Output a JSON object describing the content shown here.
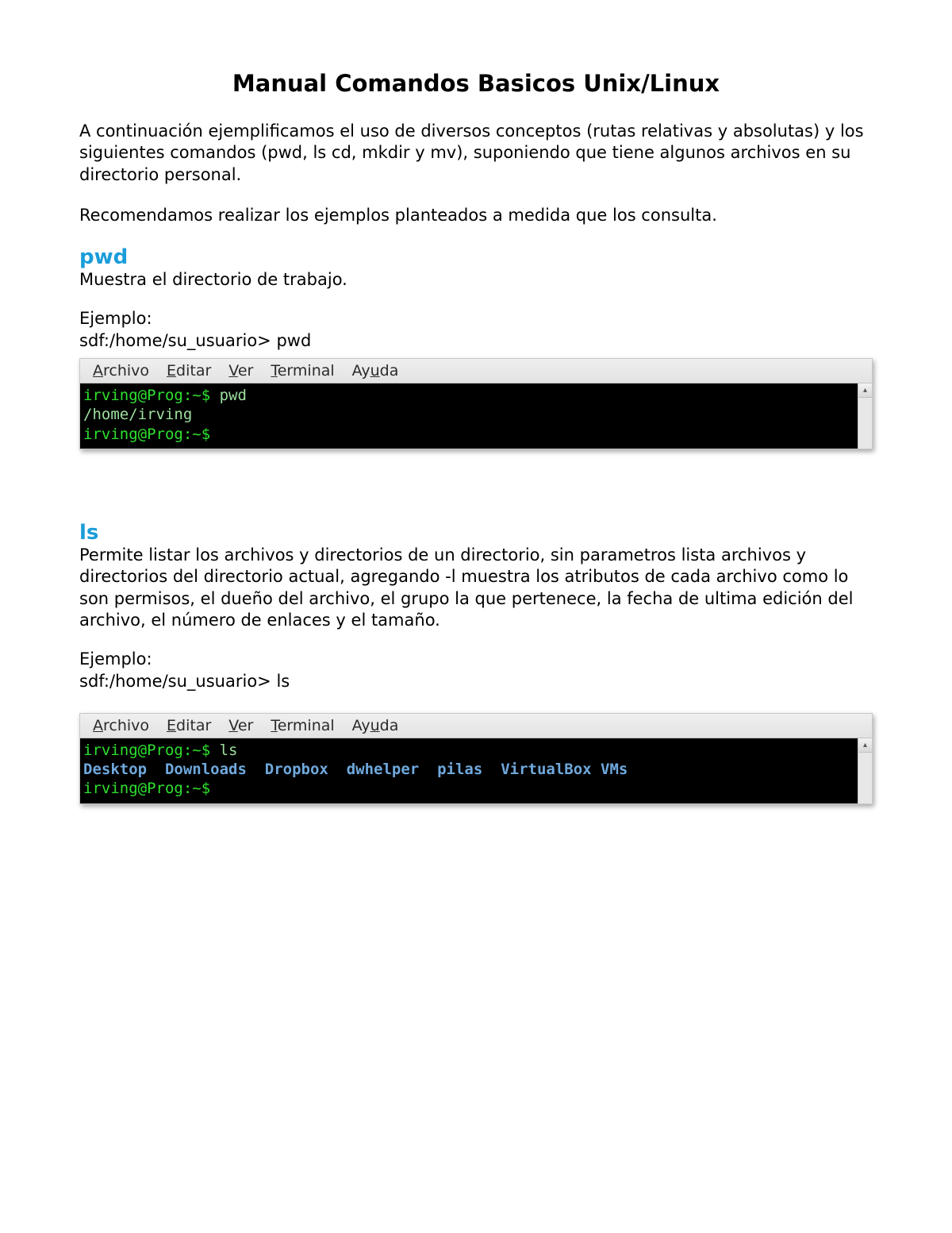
{
  "title": "Manual Comandos Basicos Unix/Linux",
  "intro1": "A continuación ejemplificamos el uso de diversos conceptos (rutas relativas y absolutas) y los siguientes comandos (pwd, ls cd, mkdir y mv), suponiendo que tiene algunos archivos en su directorio personal.",
  "intro2": "Recomendamos realizar los ejemplos planteados a medida que los consulta.",
  "menubar": {
    "archivo_u": "A",
    "archivo_r": "rchivo",
    "editar_u": "E",
    "editar_r": "ditar",
    "ver_u": "V",
    "ver_r": "er",
    "terminal_u": "T",
    "terminal_r": "erminal",
    "ayuda_pre": "Ay",
    "ayuda_u": "u",
    "ayuda_post": "da"
  },
  "pwd": {
    "heading": "pwd",
    "desc": "Muestra el directorio de trabajo.",
    "example_label": "Ejemplo:",
    "example_line": "sdf:/home/su_usuario> pwd",
    "term": {
      "prompt1": "irving@Prog:~$ ",
      "cmd1": "pwd",
      "out1": "/home/irving",
      "prompt2": "irving@Prog:~$ "
    }
  },
  "ls": {
    "heading": "ls",
    "desc": "Permite listar los archivos y directorios de un directorio, sin parametros lista archivos y directorios del directorio actual, agregando -l muestra los atributos de cada archivo como lo son permisos, el dueño del archivo, el grupo la que pertenece, la fecha de ultima edición del archivo, el número de enlaces y el tamaño.",
    "example_label": "Ejemplo:",
    "example_line": "sdf:/home/su_usuario> ls",
    "term": {
      "prompt1": "irving@Prog:~$ ",
      "cmd1": "ls",
      "out1": "Desktop  Downloads  Dropbox  dwhelper  pilas  VirtualBox VMs",
      "prompt2": "irving@Prog:~$ "
    }
  }
}
